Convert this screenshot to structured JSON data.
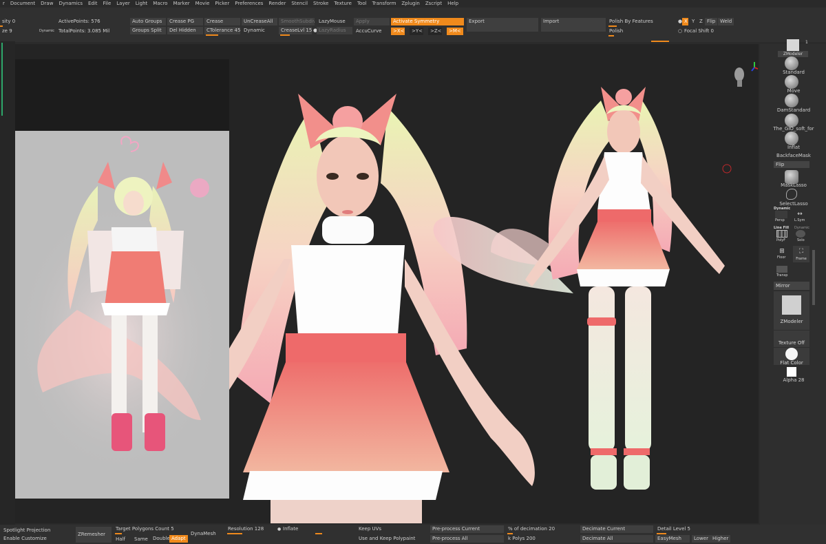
{
  "menu": [
    "r",
    "Document",
    "Draw",
    "Dynamics",
    "Edit",
    "File",
    "Layer",
    "Light",
    "Macro",
    "Marker",
    "Movie",
    "Picker",
    "Preferences",
    "Render",
    "Stencil",
    "Stroke",
    "Texture",
    "Tool",
    "Transform",
    "Zplugin",
    "Zscript",
    "Help"
  ],
  "top": {
    "intensity": "sity 0",
    "drawsize": "ze 9",
    "dynamic": "Dynamic",
    "active_points": "ActivePoints: 576",
    "total_points": "TotalPoints: 3.085 Mil",
    "auto_groups": "Auto Groups",
    "groups_split": "Groups Split",
    "crease_pg": "Crease PG",
    "del_hidden": "Del Hidden",
    "crease": "Crease",
    "ctolerance": "CTolerance 45",
    "uncrease_all": "UnCreaseAll",
    "dynamic2": "Dynamic",
    "smooth_subdiv": "SmoothSubdiv",
    "crease_lvl": "CreaseLvl 15",
    "lazy_mouse": "LazyMouse",
    "lazy_radius": "LazyRadius",
    "apply": "Apply",
    "accu_curve": "AccuCurve",
    "activate_symmetry": "Activate Symmetry",
    "sym_x": ">X<",
    "sym_y": ">Y<",
    "sym_z": ">Z<",
    "sym_m": ">M<",
    "export": "Export",
    "import": "Import",
    "polish_by_features": "Polish By Features",
    "polish": "Polish",
    "x": "X",
    "y": "Y",
    "z": "Z",
    "flip": "Flip",
    "weld": "Weld",
    "focal_shift": "Focal Shift 0"
  },
  "right": {
    "zmodeler_top": "ZModeler",
    "count": "1",
    "standard": "Standard",
    "move": "Move",
    "damstandard": "DamStandard",
    "gio": "The_GIO_soft_for",
    "inflat": "Inflat",
    "backface": "BackfaceMask",
    "flip": "Flip",
    "masklasso": "MaskLasso",
    "selectlasso": "SelectLasso",
    "dynamic": "Dynamic",
    "persp": "Persp",
    "lsym": "L.Sym",
    "linefill": "Line Fill",
    "polyf": "PolyF",
    "dynamic2": "Dynamic",
    "solo": "Solo",
    "floor": "Floor",
    "frame": "Frame",
    "transp": "Transp",
    "mirror": "Mirror",
    "zmodeler": "ZModeler",
    "texture_off": "Texture Off",
    "flat_color": "Flat Color",
    "alpha": "Alpha 28"
  },
  "bottom": {
    "spotlight": "Spotlight Projection",
    "enable_customize": "Enable Customize",
    "zremesher": "ZRemesher",
    "target_polys": "Target Polygons Count 5",
    "half": "Half",
    "same": "Same",
    "double": "Double",
    "adapt": "Adapt",
    "dynamesh": "DynaMesh",
    "resolution": "Resolution 128",
    "inflate": "Inflate",
    "keep_uvs": "Keep UVs",
    "use_keep_polypaint": "Use and Keep Polypaint",
    "preprocess_current": "Pre-process Current",
    "preprocess_all": "Pre-process All",
    "pct_decimation": "% of decimation 20",
    "k_polys": "k Polys 200",
    "decimate_current": "Decimate Current",
    "decimate_all": "Decimate All",
    "detail_level": "Detail Level 5",
    "easymesh": "EasyMesh",
    "lower": "Lower",
    "higher": "Higher"
  },
  "colors": {
    "accent": "#f08a1c",
    "panel": "#303030",
    "canvas": "#242424"
  }
}
